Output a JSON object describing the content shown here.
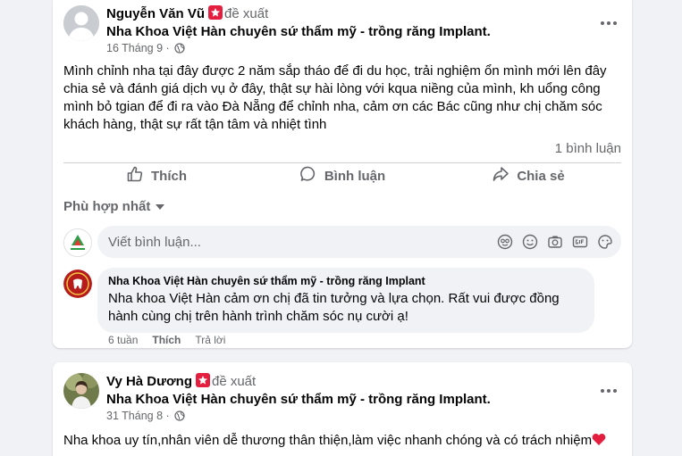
{
  "colors": {
    "background": "#f0f2f5",
    "card": "#ffffff",
    "secondary_text": "#65676b",
    "badge_red": "#e41e3f",
    "heart": "#e41e3f"
  },
  "posts": [
    {
      "author": "Nguyễn Văn Vũ",
      "badge_icon": "star-badge-icon",
      "suggest_label": "đề xuất",
      "page": "Nha Khoa Việt Hàn chuyên sứ thẩm mỹ - trồng răng Implant.",
      "date": "16 Tháng 9 ·",
      "privacy_icon": "globe-icon",
      "more_icon": "more-horizontal-icon",
      "text_lines": [
        "Mình chỉnh nha tại đây được 2 năm sắp tháo để đi du học, trải nghiệm ổn mình mới lên đây",
        "chia sẻ và đánh giá dịch vụ ở đây, thật sự hài lòng với kqua niềng của mình, kh uổng công",
        "mình bỏ tgian để đi ra vào Đà Nẵng để chỉnh nha, cảm ơn các Bác cũng như chị chăm sóc",
        "khách hàng, thật sự rất tận tâm và nhiệt tình"
      ],
      "comment_count": "1 bình luận",
      "actions": [
        {
          "label": "Thích",
          "icon": "like-icon"
        },
        {
          "label": "Bình luận",
          "icon": "comment-icon"
        },
        {
          "label": "Chia sẻ",
          "icon": "share-icon"
        }
      ],
      "sort_label": "Phù hợp nhất",
      "composer": {
        "placeholder": "Viết bình luận...",
        "tools": [
          "sticker-avatar-icon",
          "emoji-icon",
          "camera-icon",
          "gif-icon",
          "sticker-icon"
        ]
      },
      "reply": {
        "author": "Nha Khoa Việt Hàn chuyên sứ thẩm mỹ - trồng răng Implant",
        "text_lines": [
          "Nha khoa Việt Hàn cảm ơn chị đã tin tưởng và lựa chọn. Rất vui được đồng",
          "hành cùng chị trên hành trình chăm sóc nụ cười ạ!"
        ],
        "time": "6 tuần",
        "like_label": "Thích",
        "reply_label": "Trả lời"
      }
    },
    {
      "author": "Vy Hà Dương",
      "badge_icon": "star-badge-icon",
      "suggest_label": "đề xuất",
      "page": "Nha Khoa Việt Hàn chuyên sứ thẩm mỹ - trồng răng Implant.",
      "date": "31 Tháng 8 ·",
      "privacy_icon": "globe-icon",
      "more_icon": "more-horizontal-icon",
      "text": "Nha khoa uy tín,nhân viên dễ thương thân thiện,làm việc nhanh chóng và có trách nhiệm",
      "trailing_emoji": "heart-icon"
    }
  ]
}
